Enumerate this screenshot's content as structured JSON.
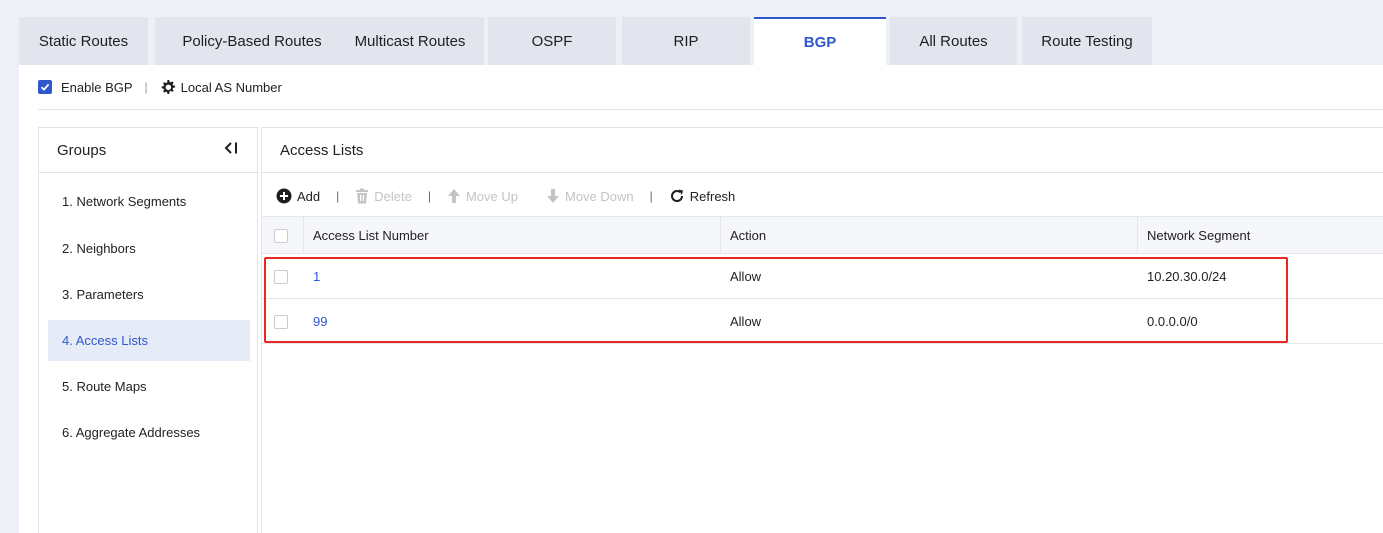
{
  "tabs": [
    {
      "label": "Static Routes"
    },
    {
      "label": "Policy-Based Routes"
    },
    {
      "label": "Multicast Routes"
    },
    {
      "label": "OSPF"
    },
    {
      "label": "RIP"
    },
    {
      "label": "BGP",
      "active": true
    },
    {
      "label": "All Routes"
    },
    {
      "label": "Route Testing"
    }
  ],
  "top": {
    "enable_bgp_label": "Enable BGP",
    "enable_bgp_checked": true,
    "separator": "|",
    "local_as_label": "Local AS Number"
  },
  "groups": {
    "title": "Groups",
    "collapse_icon": "collapse-left-icon",
    "items": [
      {
        "label": "1. Network Segments"
      },
      {
        "label": "2. Neighbors"
      },
      {
        "label": "3. Parameters"
      },
      {
        "label": "4. Access Lists",
        "active": true
      },
      {
        "label": "5. Route Maps"
      },
      {
        "label": "6. Aggregate Addresses"
      }
    ]
  },
  "content": {
    "title": "Access Lists",
    "toolbar": {
      "add": "Add",
      "delete": "Delete",
      "move_up": "Move Up",
      "move_down": "Move Down",
      "refresh": "Refresh",
      "sep": "|"
    },
    "table": {
      "columns": [
        "Access List Number",
        "Action",
        "Network Segment"
      ],
      "rows": [
        {
          "number": "1",
          "action": "Allow",
          "segment": "10.20.30.0/24"
        },
        {
          "number": "99",
          "action": "Allow",
          "segment": "0.0.0.0/0"
        }
      ]
    }
  },
  "colors": {
    "accent": "#2f58cd",
    "highlight_border": "#e8281f",
    "tab_inactive_bg": "#e2e5ee",
    "page_bg": "#eef0f8"
  }
}
